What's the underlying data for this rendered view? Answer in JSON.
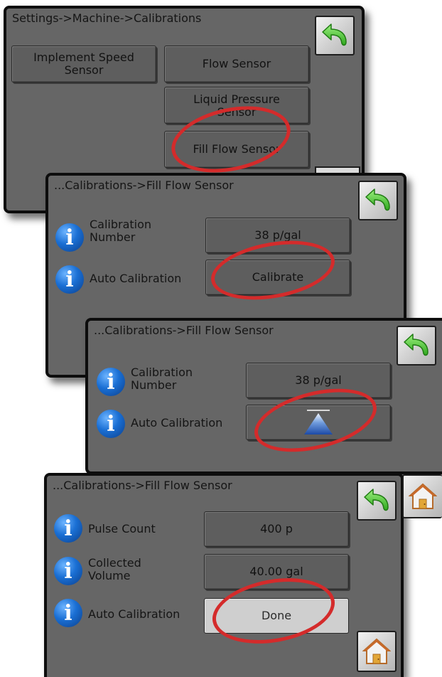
{
  "colors": {
    "panel_bg": "#666666",
    "highlight_ring": "#d42b2b",
    "info_icon": "#1a6fd4",
    "back_arrow": "#4fd13a"
  },
  "screen1": {
    "breadcrumb": "Settings->Machine->Calibrations",
    "buttons": {
      "implement_speed": "Implement Speed Sensor",
      "flow_sensor": "Flow Sensor",
      "liquid_pressure": "Liquid Pressure Sensor",
      "fill_flow": "Fill Flow Sensor"
    },
    "back_icon": "back-arrow-icon"
  },
  "screen2": {
    "breadcrumb": "...Calibrations->Fill Flow Sensor",
    "rows": [
      {
        "label": "Calibration Number",
        "value": "38 p/gal"
      },
      {
        "label": "Auto Calibration",
        "value": "Calibrate"
      }
    ]
  },
  "screen3": {
    "breadcrumb": "...Calibrations->Fill Flow Sensor",
    "rows": [
      {
        "label": "Calibration Number",
        "value": "38 p/gal"
      },
      {
        "label": "Auto Calibration",
        "value_icon": "start-triangle-icon"
      }
    ]
  },
  "screen4": {
    "breadcrumb": "...Calibrations->Fill Flow Sensor",
    "rows": [
      {
        "label": "Pulse Count",
        "value": "400 p"
      },
      {
        "label": "Collected Volume",
        "value": "40.00 gal"
      },
      {
        "label": "Auto Calibration",
        "value": "Done"
      }
    ],
    "home_icon": "home-icon"
  }
}
